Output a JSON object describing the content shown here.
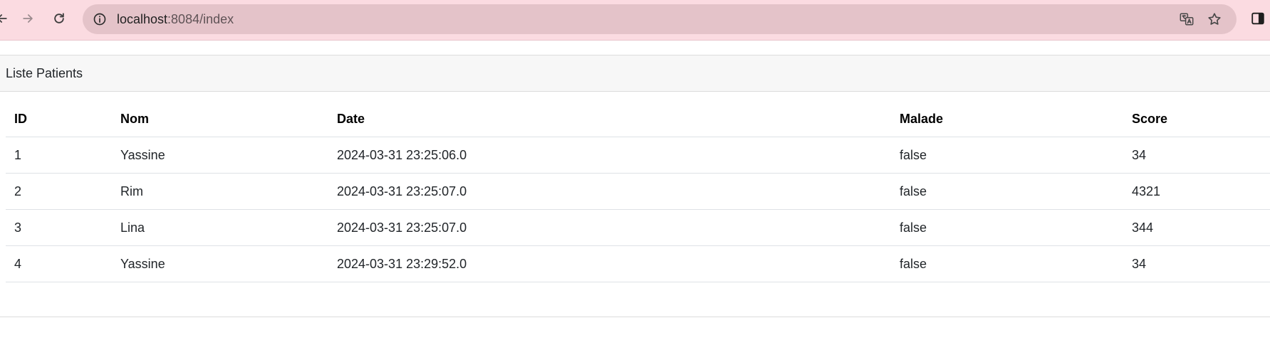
{
  "browser": {
    "url_host": "localhost",
    "url_rest": ":8084/index",
    "icons": {
      "back": "back-arrow-icon",
      "forward": "forward-arrow-icon",
      "reload": "reload-icon",
      "site_info": "info-icon",
      "translate": "translate-icon",
      "bookmark": "star-icon",
      "side_panel": "side-panel-icon"
    },
    "colors": {
      "toolbar": "#fbdbe1",
      "omnibox": "#e4c3c9"
    }
  },
  "card": {
    "header": "Liste Patients"
  },
  "table": {
    "columns": [
      "ID",
      "Nom",
      "Date",
      "Malade",
      "Score"
    ],
    "rows": [
      {
        "id": "1",
        "nom": "Yassine",
        "date": "2024-03-31 23:25:06.0",
        "malade": "false",
        "score": "34"
      },
      {
        "id": "2",
        "nom": "Rim",
        "date": "2024-03-31 23:25:07.0",
        "malade": "false",
        "score": "4321"
      },
      {
        "id": "3",
        "nom": "Lina",
        "date": "2024-03-31 23:25:07.0",
        "malade": "false",
        "score": "344"
      },
      {
        "id": "4",
        "nom": "Yassine",
        "date": "2024-03-31 23:29:52.0",
        "malade": "false",
        "score": "34"
      }
    ]
  }
}
